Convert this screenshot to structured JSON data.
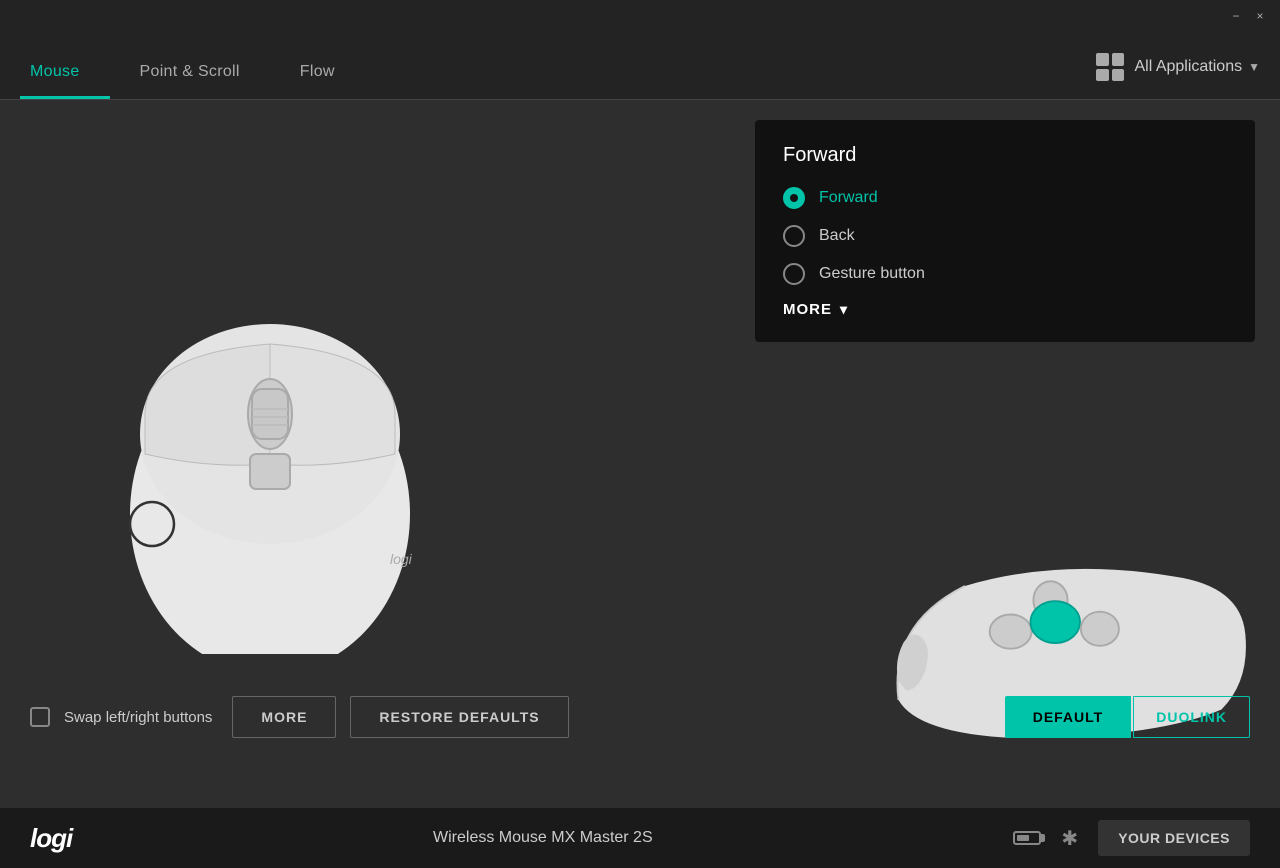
{
  "titlebar": {
    "minimize_label": "−",
    "close_label": "×"
  },
  "header": {
    "tabs": [
      {
        "id": "mouse",
        "label": "Mouse",
        "active": true
      },
      {
        "id": "point-scroll",
        "label": "Point & Scroll",
        "active": false
      },
      {
        "id": "flow",
        "label": "Flow",
        "active": false
      }
    ],
    "all_applications_label": "All Applications"
  },
  "popup": {
    "title": "Forward",
    "options": [
      {
        "id": "forward",
        "label": "Forward",
        "selected": true
      },
      {
        "id": "back",
        "label": "Back",
        "selected": false
      },
      {
        "id": "gesture",
        "label": "Gesture button",
        "selected": false
      }
    ],
    "more_label": "MORE"
  },
  "bottom": {
    "swap_label": "Swap left/right buttons",
    "more_label": "MORE",
    "restore_label": "RESTORE DEFAULTS",
    "default_label": "DEFAULT",
    "duolink_label": "DUOLINK"
  },
  "footer": {
    "logo": "logi",
    "device_name": "Wireless Mouse MX Master 2S",
    "your_devices_label": "YOUR DEVICES"
  },
  "colors": {
    "accent": "#00c4aa",
    "background": "#2e2e2e",
    "header_bg": "#232323",
    "popup_bg": "#111",
    "footer_bg": "#1a1a1a"
  }
}
